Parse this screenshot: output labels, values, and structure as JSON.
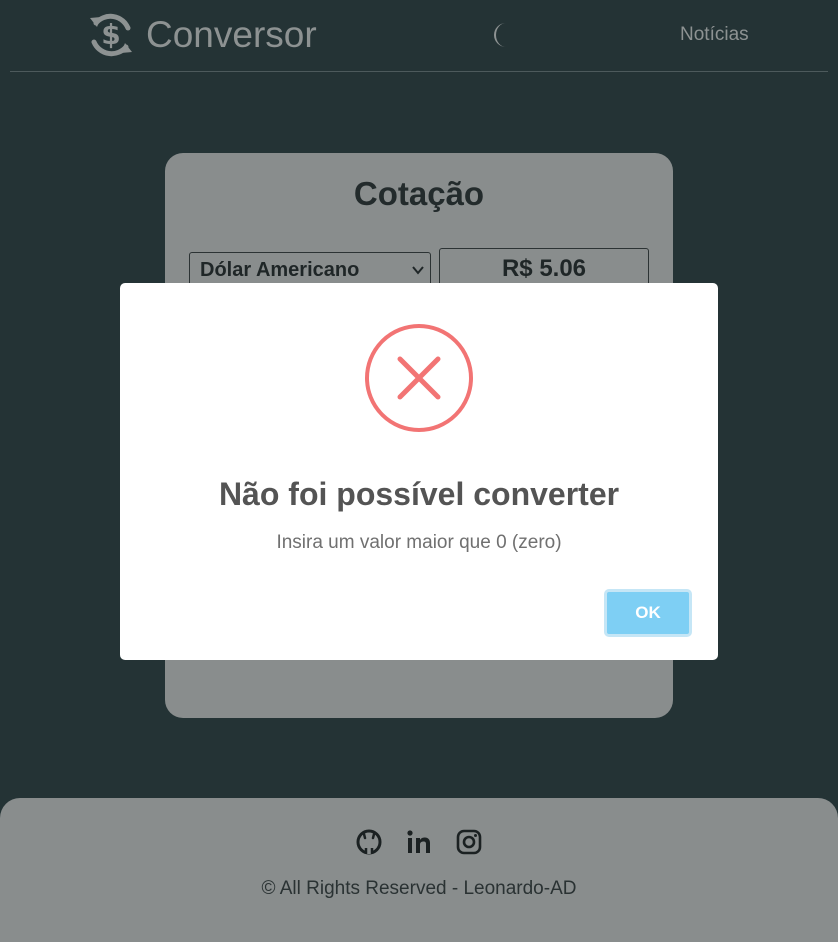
{
  "header": {
    "title": "Conversor",
    "brand_icon": "currency-exchange-icon",
    "theme_icon": "moon-icon",
    "nav_news": "Notícias"
  },
  "card": {
    "title": "Cotação",
    "currency_selected": "Dólar Americano",
    "rate": "R$ 5.06"
  },
  "modal": {
    "icon": "error-x-icon",
    "title": "Não foi possível converter",
    "text": "Insira um valor maior que 0 (zero)",
    "ok_label": "OK"
  },
  "footer": {
    "social_icons": [
      "github-icon",
      "linkedin-icon",
      "instagram-icon"
    ],
    "copyright": "© All Rights Reserved - Leonardo-AD"
  },
  "colors": {
    "background": "#243335",
    "card": "#898d8d",
    "error": "#f27474",
    "ok_button": "#7ecff4"
  }
}
